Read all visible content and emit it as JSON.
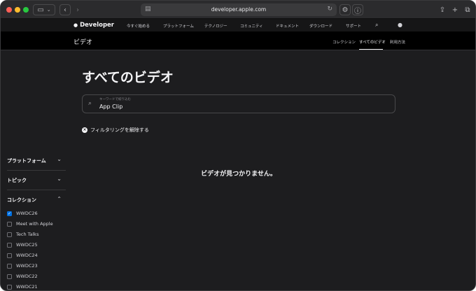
{
  "browser": {
    "url": "developer.apple.com"
  },
  "globalnav": {
    "logo": "Developer",
    "items": [
      "今すぐ始める",
      "プラットフォーム",
      "テクノロジー",
      "コミュニティ",
      "ドキュメント",
      "ダウンロード",
      "サポート"
    ]
  },
  "localnav": {
    "title": "ビデオ",
    "links": [
      "コレクション",
      "すべてのビデオ",
      "利用方法"
    ],
    "active": "すべてのビデオ"
  },
  "main": {
    "title": "すべてのビデオ",
    "search": {
      "label": "キーワードで絞り込む",
      "value": "App Clip"
    },
    "clear_filters": "フィルタリングを解除する",
    "empty_message": "ビデオが見つかりません。"
  },
  "filters": {
    "platform": "プラットフォーム",
    "topic": "トピック",
    "collection": "コレクション",
    "collection_items": [
      {
        "label": "WWDC26",
        "checked": true
      },
      {
        "label": "Meet with Apple",
        "checked": false
      },
      {
        "label": "Tech Talks",
        "checked": false
      },
      {
        "label": "WWDC25",
        "checked": false
      },
      {
        "label": "WWDC24",
        "checked": false
      },
      {
        "label": "WWDC23",
        "checked": false
      },
      {
        "label": "WWDC22",
        "checked": false
      },
      {
        "label": "WWDC21",
        "checked": false
      }
    ]
  }
}
